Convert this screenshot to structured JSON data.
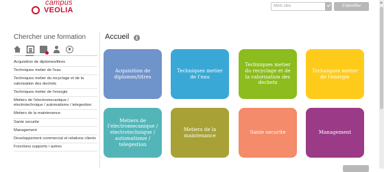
{
  "header": {
    "logo_top": "campus",
    "logo_main": "VEOLIA",
    "search_placeholder": "Mots clés",
    "login_label": "S'identifier"
  },
  "sidebar": {
    "title": "Chercher une formation",
    "icons": [
      "home-icon",
      "document-icon",
      "calendar-icon",
      "user-icon",
      "globe-icon"
    ],
    "items": [
      "Acquisition de diplomes/titres",
      "Techniques metier de l'eau",
      "Techniques metier du recyclage et de la valorisation des dechets",
      "Techniques metier de l'energie",
      "Metiers de l'electromecanique / electrotechnique / automatisme / telegestion",
      "Metiers de la maintenance",
      "Sante securite",
      "Management",
      "Developpement commercial et relations clients",
      "Fonctions supports / autres"
    ]
  },
  "main": {
    "title": "Accueil",
    "info_glyph": "i",
    "tiles": [
      {
        "label": "Acquisition de diplomes/titres",
        "color": "#6f93cb"
      },
      {
        "label": "Techniques metier de l'eau",
        "color": "#3aa8d6"
      },
      {
        "label": "Techniques metier du recyclage et de la valorisation des dechets",
        "color": "#8cbc1d"
      },
      {
        "label": "Techniques metier de l'energie",
        "color": "#ffcb1b"
      },
      {
        "label": "Metiers de l'electromecanique / electrotechnique / automatisme / telegestion",
        "color": "#54b5b8"
      },
      {
        "label": "Metiers de la maintenance",
        "color": "#a8a236"
      },
      {
        "label": "Sante securite",
        "color": "#f48b6a"
      },
      {
        "label": "Management",
        "color": "#9b3a87"
      }
    ]
  },
  "colors": {
    "brand": "#c8102e",
    "button_gray": "#b8b8b8"
  }
}
